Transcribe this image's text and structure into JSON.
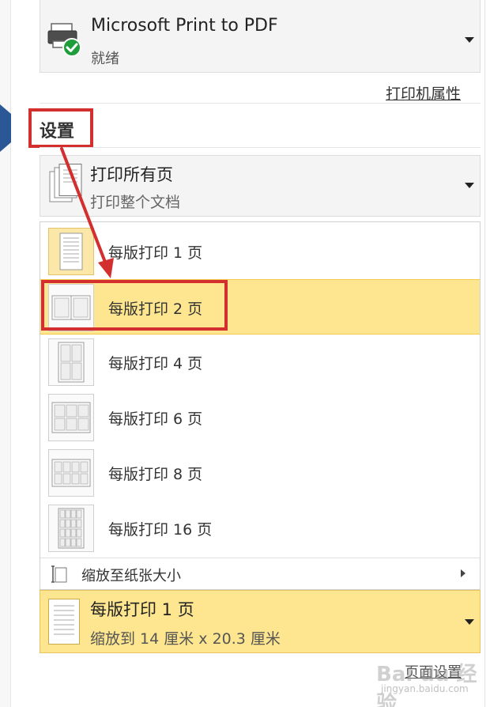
{
  "printer": {
    "name": "Microsoft Print to PDF",
    "status": "就绪",
    "properties_link": "打印机属性"
  },
  "settings": {
    "title": "设置",
    "pages_main": "打印所有页",
    "pages_sub": "打印整个文档"
  },
  "pages_per_sheet_menu": {
    "items": [
      {
        "label": "每版打印 1 页",
        "icon": "one-page-icon"
      },
      {
        "label": "每版打印 2 页",
        "icon": "two-page-icon"
      },
      {
        "label": "每版打印 4 页",
        "icon": "four-page-icon"
      },
      {
        "label": "每版打印 6 页",
        "icon": "six-page-icon"
      },
      {
        "label": "每版打印 8 页",
        "icon": "eight-page-icon"
      },
      {
        "label": "每版打印 16 页",
        "icon": "sixteen-page-icon"
      }
    ],
    "selected_index": 1,
    "current_index": 0,
    "scale_label": "缩放至纸张大小"
  },
  "collapsed": {
    "main": "每版打印 1 页",
    "sub": "缩放到 14 厘米 x 20.3 厘米"
  },
  "footer": {
    "page_setup_link": "页面设置"
  },
  "watermark": {
    "text": "Bai du 经验",
    "sub": "jingyan.baidu.com"
  },
  "colors": {
    "highlight": "#fde68f",
    "annotation_red": "#d32f2f",
    "accent_blue": "#2b5797",
    "status_green": "#1e9e3a"
  }
}
